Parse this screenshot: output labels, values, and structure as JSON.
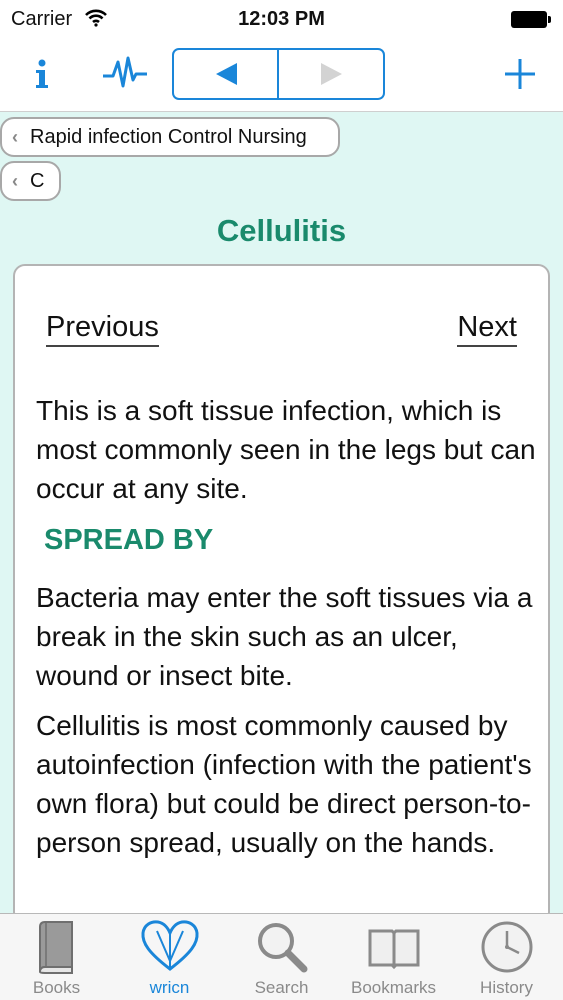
{
  "status_bar": {
    "carrier": "Carrier",
    "time": "12:03 PM"
  },
  "toolbar": {
    "info_icon": "info-icon",
    "pulse_icon": "pulse-icon",
    "back_icon": "triangle-left-icon",
    "forward_icon": "triangle-right-icon",
    "add_icon": "plus-icon",
    "accent_color": "#1a86d9"
  },
  "breadcrumbs": [
    {
      "label": "Rapid infection Control Nursing"
    },
    {
      "label": "C"
    }
  ],
  "page": {
    "title": "Cellulitis",
    "title_color": "#1a8a6c"
  },
  "content": {
    "previous_label": "Previous",
    "next_label": "Next",
    "paragraph_1": "This is a soft tissue infection, which is most commonly seen in the legs but can occur at any site.",
    "section_heading": "SPREAD BY",
    "paragraph_2": "Bacteria may enter the soft tissues via a break in the skin such as an ulcer, wound or insect bite.",
    "paragraph_3": "Cellulitis is most commonly caused by autoinfection (infection with the patient's own flora) but could be direct person-to-person spread, usually on the hands."
  },
  "tab_bar": {
    "tabs": [
      {
        "label": "Books",
        "icon": "book-icon",
        "active": false
      },
      {
        "label": "wricn",
        "icon": "heart-icon",
        "active": true
      },
      {
        "label": "Search",
        "icon": "magnifier-icon",
        "active": false
      },
      {
        "label": "Bookmarks",
        "icon": "open-book-icon",
        "active": false
      },
      {
        "label": "History",
        "icon": "clock-icon",
        "active": false
      }
    ]
  }
}
